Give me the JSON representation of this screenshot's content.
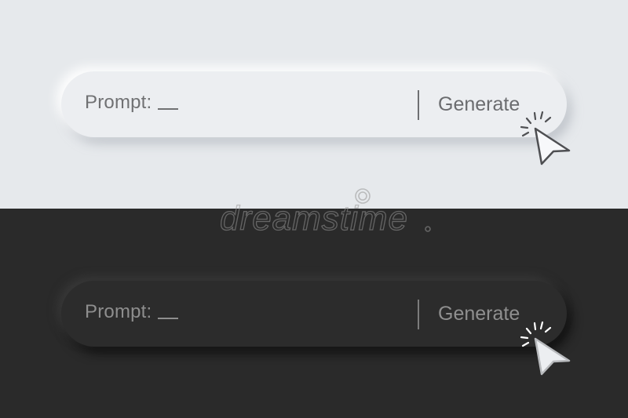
{
  "light_prompt_bar": {
    "label": "Prompt:",
    "button_label": "Generate"
  },
  "dark_prompt_bar": {
    "label": "Prompt:",
    "button_label": "Generate"
  },
  "watermark": {
    "text": "dreamstime"
  },
  "icons": {
    "cursor": "arrow-cursor-icon",
    "click_burst": "click-burst-icon",
    "watermark_logo": "dreamstime-logo"
  },
  "colors": {
    "light_background": "#e6e9ec",
    "light_bar": "#eceef1",
    "dark_background": "#2a2a2a",
    "dark_bar": "#2c2c2c",
    "text_gray": "#707173"
  }
}
